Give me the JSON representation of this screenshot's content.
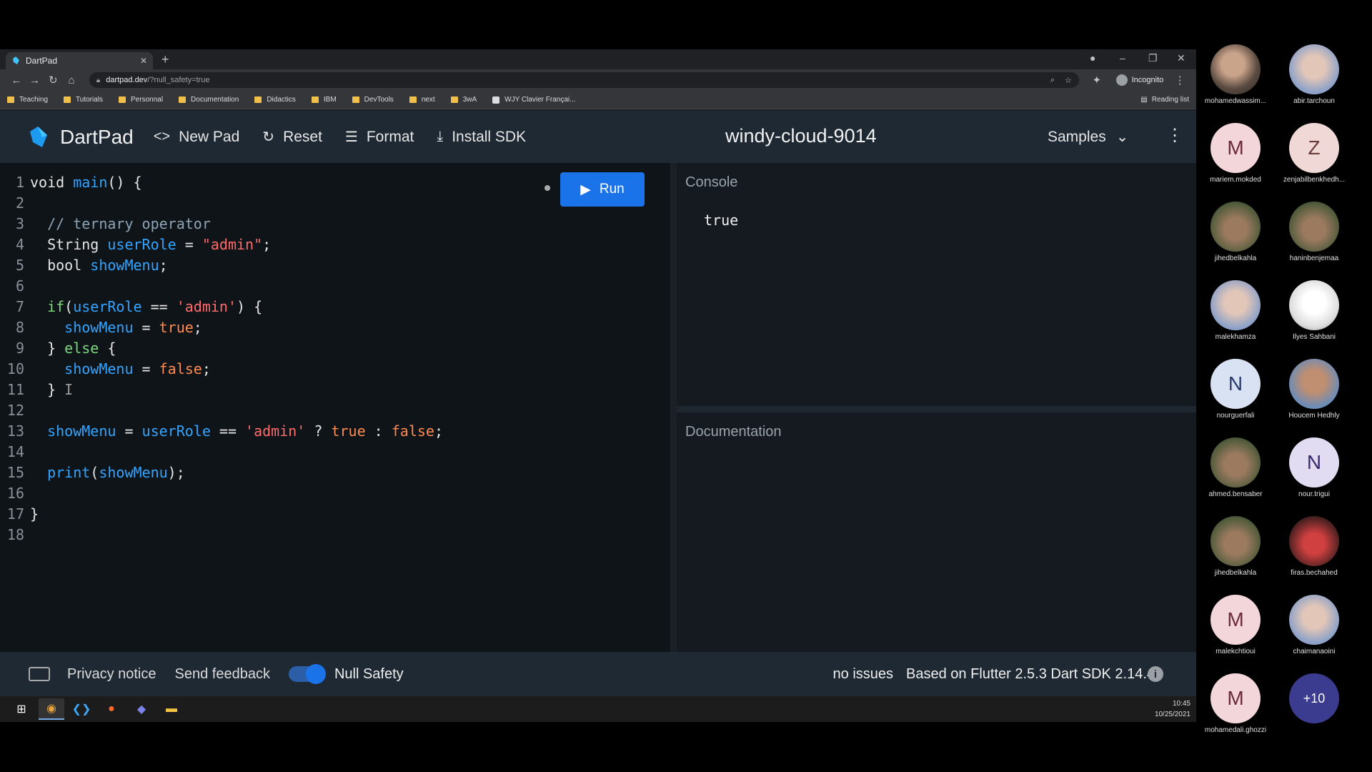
{
  "browser": {
    "tab_title": "DartPad",
    "url_host": "dartpad.dev",
    "url_path": "/?null_safety=true",
    "incognito_label": "Incognito",
    "reading_list": "Reading list",
    "bookmarks": [
      "Teaching",
      "Tutorials",
      "Personnal",
      "Documentation",
      "Didactics",
      "IBM",
      "DevTools",
      "next",
      "3wA",
      "WJY Clavier Françai..."
    ]
  },
  "app": {
    "brand": "DartPad",
    "new_pad": "New Pad",
    "reset": "Reset",
    "format": "Format",
    "install_sdk": "Install SDK",
    "pad_name": "windy-cloud-9014",
    "samples": "Samples",
    "run": "Run"
  },
  "console": {
    "title": "Console",
    "output": "true"
  },
  "documentation": {
    "title": "Documentation"
  },
  "status": {
    "privacy": "Privacy notice",
    "feedback": "Send feedback",
    "null_safety": "Null Safety",
    "issues": "no issues",
    "version": "Based on Flutter 2.5.3 Dart SDK 2.14.4"
  },
  "taskbar": {
    "time": "10:45",
    "date": "10/25/2021"
  },
  "participants": [
    {
      "name": "mohamedwassim..."
    },
    {
      "name": "abir.tarchoun"
    },
    {
      "name": "mariem.mokded",
      "initial": "M"
    },
    {
      "name": "zenjabilbenkhedh...",
      "initial": "Z"
    },
    {
      "name": "jihedbelkahla"
    },
    {
      "name": "haninbenjemaa"
    },
    {
      "name": "malekhamza"
    },
    {
      "name": "Ilyes Sahbani"
    },
    {
      "name": "nourguerfali",
      "initial": "N"
    },
    {
      "name": "Houcem Hedhly"
    },
    {
      "name": "ahmed.bensaber"
    },
    {
      "name": "nour.trigui",
      "initial": "N"
    },
    {
      "name": "jihedbelkahla"
    },
    {
      "name": "firas.bechahed"
    },
    {
      "name": "malekchtioui",
      "initial": "M"
    },
    {
      "name": "chaimanaoini"
    },
    {
      "name": "mohamedali.ghozzi",
      "initial": "M"
    },
    {
      "name": "",
      "initial": "+10"
    }
  ],
  "colors": {
    "accent": "#1a73e8",
    "editor_bg": "#0f1419",
    "appbar_bg": "#1e2933"
  }
}
